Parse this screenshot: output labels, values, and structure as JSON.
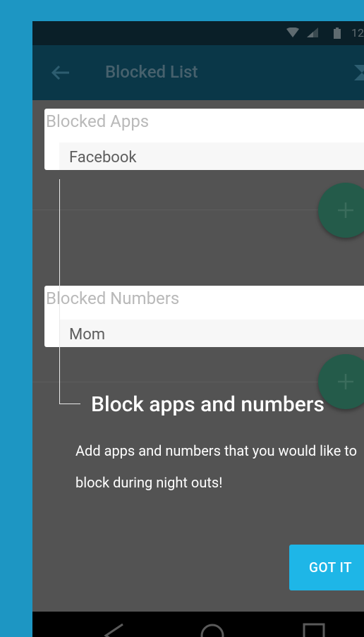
{
  "status_bar": {
    "time": "12"
  },
  "app_bar": {
    "title": "Blocked List"
  },
  "blocked_apps": {
    "label": "Blocked Apps",
    "items": [
      "Facebook"
    ]
  },
  "blocked_numbers": {
    "label": "Blocked Numbers",
    "items": [
      "Mom"
    ]
  },
  "coach_mark": {
    "title": "Block apps and numbers",
    "description": "Add apps and numbers that you would like to block during night outs!",
    "button_label": "GOT IT"
  },
  "fab": {
    "icon": "plus-icon"
  },
  "colors": {
    "background": "#1d96c3",
    "overlay": "#535353",
    "app_bar": "#0a3748",
    "fab": "#245b4a",
    "accent": "#1eb6e7"
  }
}
